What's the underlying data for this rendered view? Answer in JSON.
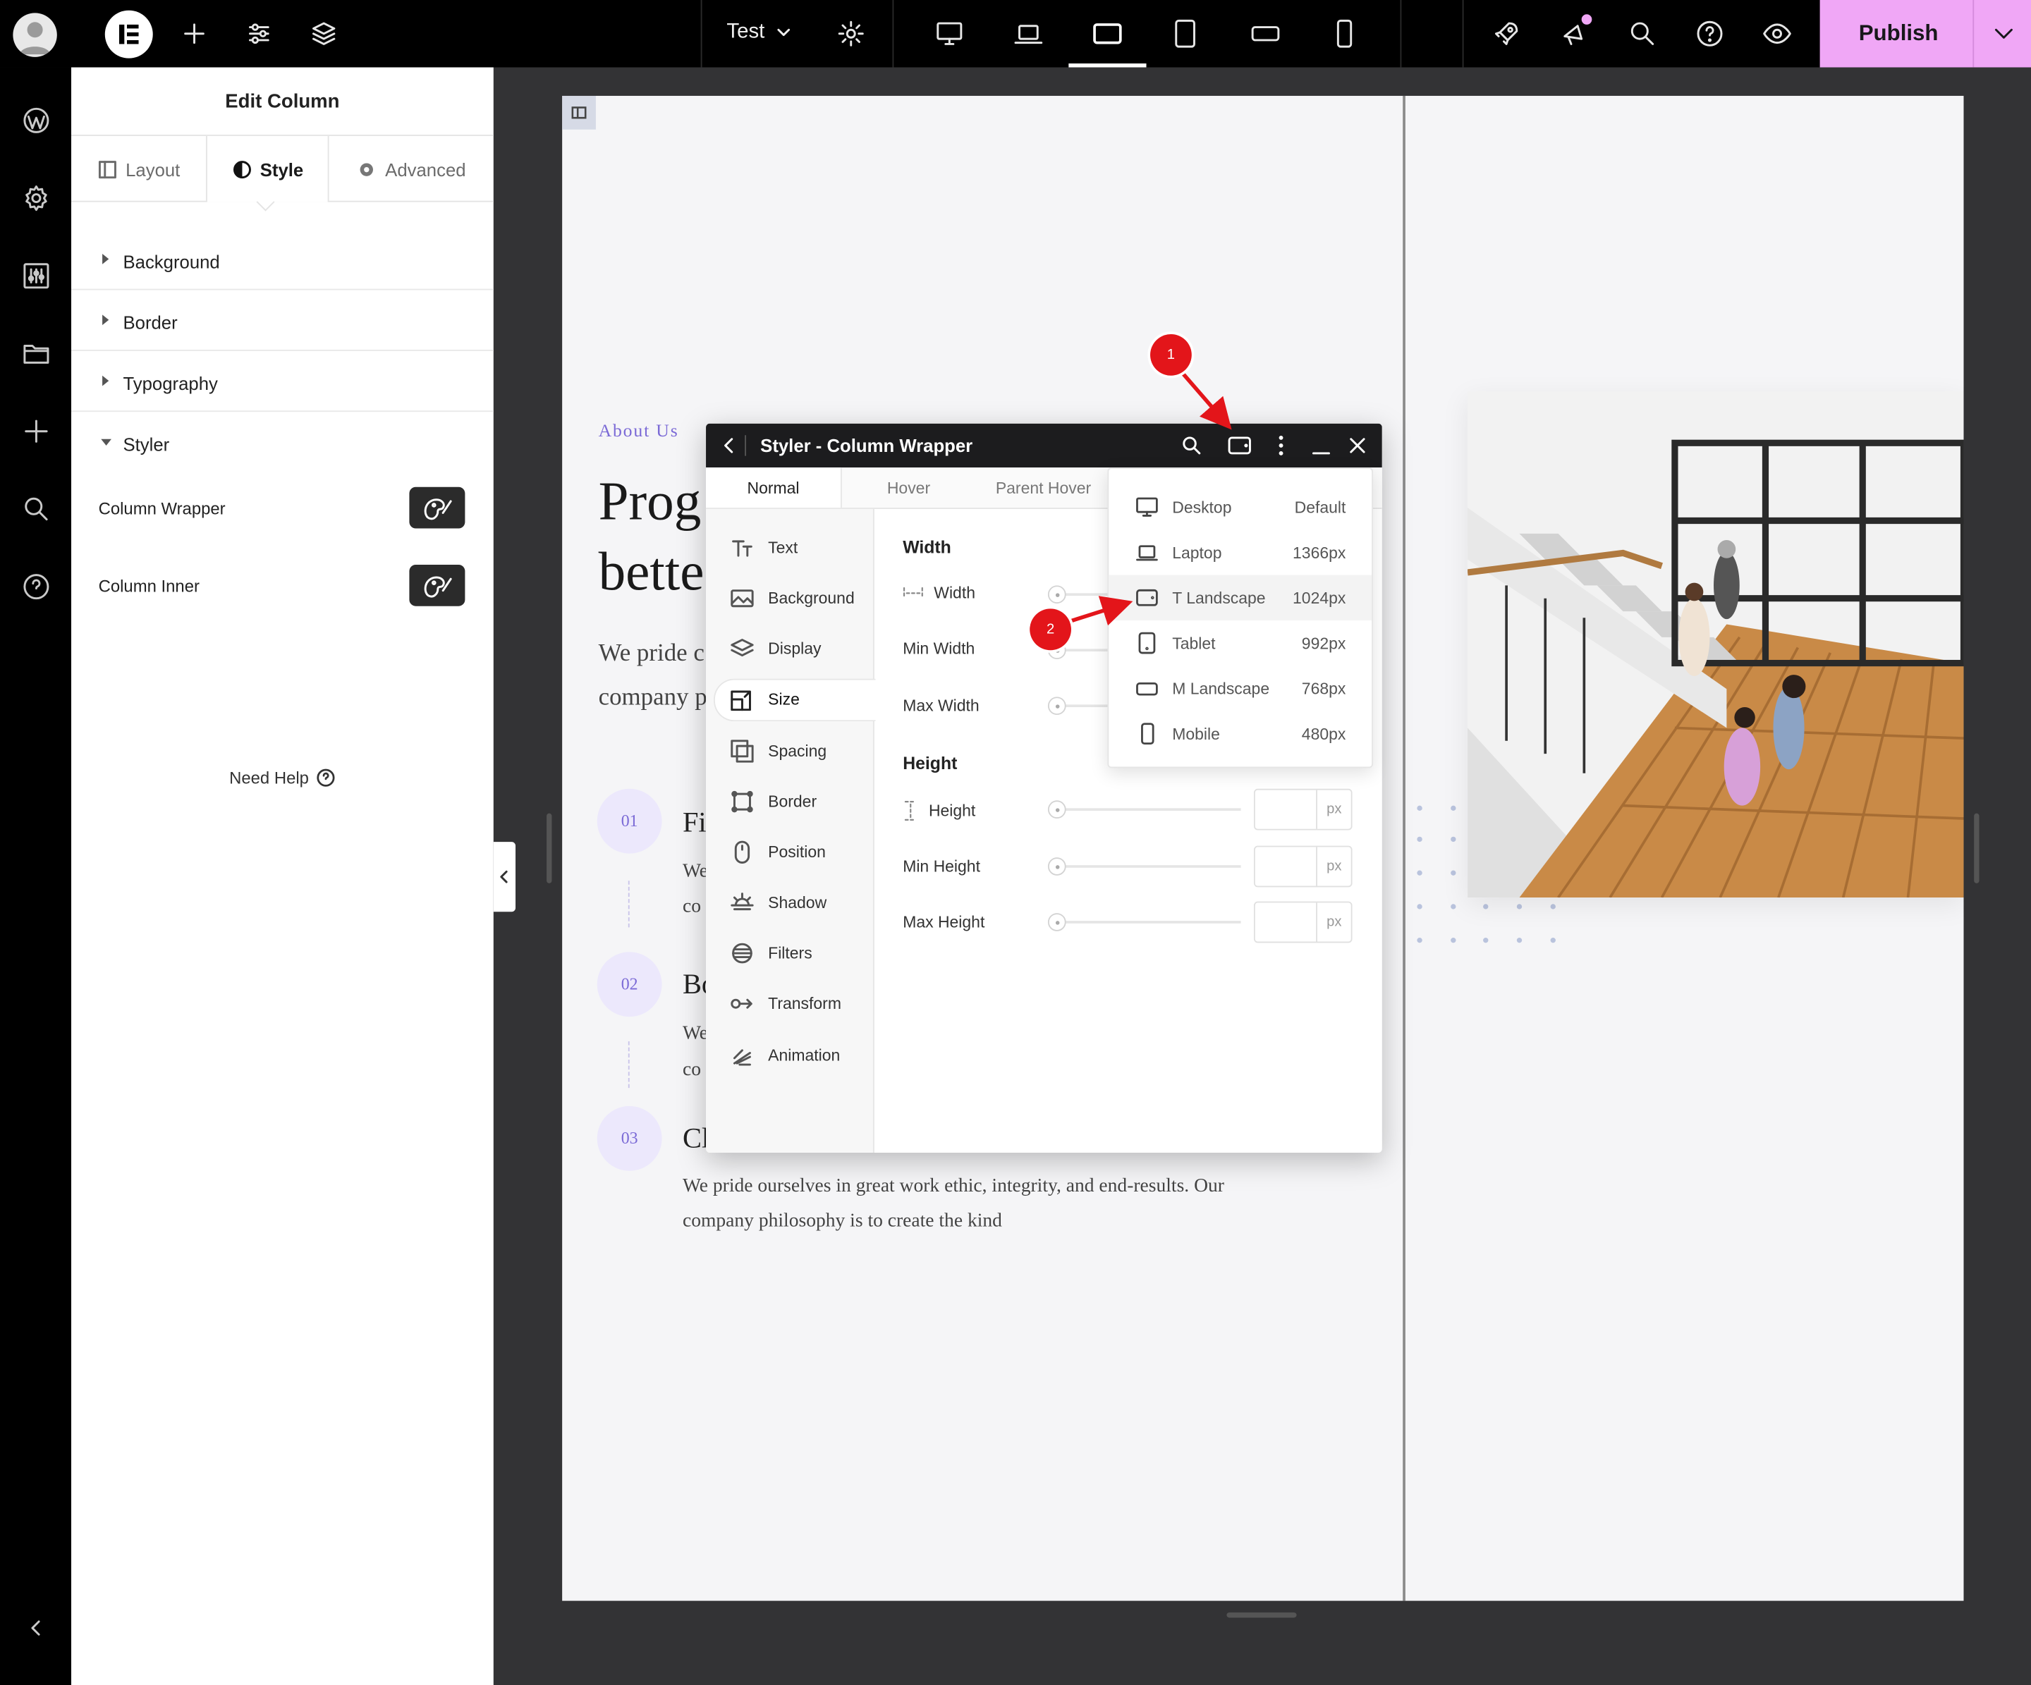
{
  "topbar": {
    "page_name": "Test",
    "publish_label": "Publish"
  },
  "panel": {
    "title": "Edit Column",
    "tabs": [
      {
        "label": "Layout"
      },
      {
        "label": "Style"
      },
      {
        "label": "Advanced"
      }
    ],
    "sections": [
      {
        "label": "Background"
      },
      {
        "label": "Border"
      },
      {
        "label": "Typography"
      },
      {
        "label": "Styler"
      }
    ],
    "styler_rows": [
      {
        "label": "Column Wrapper"
      },
      {
        "label": "Column Inner"
      }
    ],
    "need_help": "Need Help"
  },
  "canvas": {
    "eyebrow": "About Us",
    "heading_line1": "Prog",
    "heading_line2": "bette",
    "intro_line1": "We pride c",
    "intro_line2": "company p",
    "steps": [
      {
        "num": "01",
        "title": "Fi",
        "l1": "We",
        "l2": "co"
      },
      {
        "num": "02",
        "title": "Bo",
        "l1": "We",
        "l2": "co"
      },
      {
        "num": "03",
        "title": "Cl",
        "l1": "We pride ourselves in great work ethic, integrity, and end-results. Our",
        "l2": "company philosophy is to create the kind"
      }
    ]
  },
  "styler": {
    "title": "Styler - Column Wrapper",
    "state_tabs": [
      {
        "label": "Normal"
      },
      {
        "label": "Hover"
      },
      {
        "label": "Parent Hover"
      }
    ],
    "nav": [
      {
        "label": "Text"
      },
      {
        "label": "Background"
      },
      {
        "label": "Display"
      },
      {
        "label": "Size"
      },
      {
        "label": "Spacing"
      },
      {
        "label": "Border"
      },
      {
        "label": "Position"
      },
      {
        "label": "Shadow"
      },
      {
        "label": "Filters"
      },
      {
        "label": "Transform"
      },
      {
        "label": "Animation"
      }
    ],
    "width_heading": "Width",
    "width_props": [
      "Width",
      "Min Width",
      "Max Width"
    ],
    "height_heading": "Height",
    "height_props": [
      "Height",
      "Min Height",
      "Max Height"
    ],
    "unit": "px"
  },
  "breakpoints": [
    {
      "name": "Desktop",
      "value": "Default"
    },
    {
      "name": "Laptop",
      "value": "1366px"
    },
    {
      "name": "T Landscape",
      "value": "1024px"
    },
    {
      "name": "Tablet",
      "value": "992px"
    },
    {
      "name": "M Landscape",
      "value": "768px"
    },
    {
      "name": "Mobile",
      "value": "480px"
    }
  ],
  "annotations": [
    {
      "label": "1"
    },
    {
      "label": "2"
    }
  ],
  "colors": {
    "accent_publish": "#f0a7f6",
    "eyebrow_purple": "#7b6ad6",
    "step_circle": "#ece8fc",
    "annotation_red": "#e3151a"
  }
}
